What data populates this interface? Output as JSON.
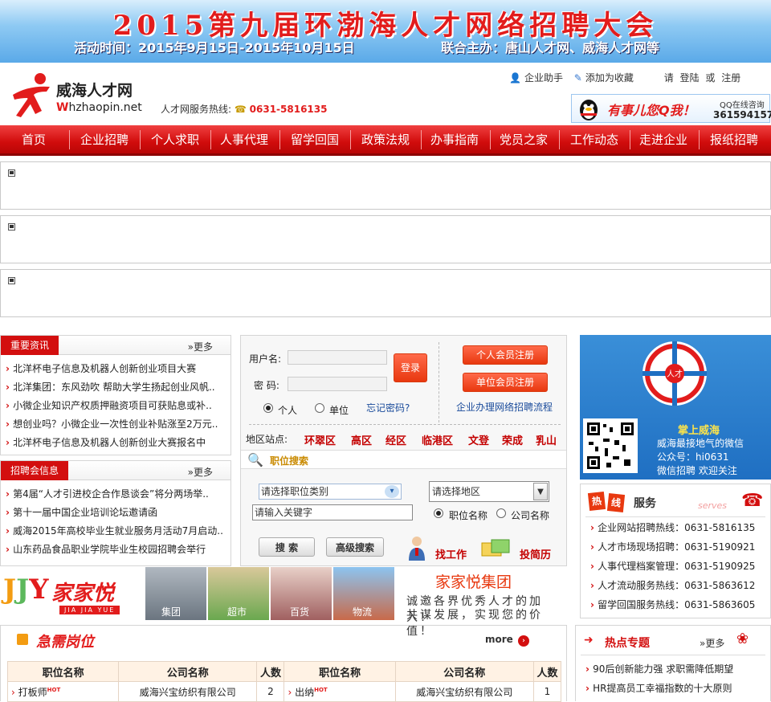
{
  "banner": {
    "title": "2015第九届环渤海人才网络招聘大会",
    "time": "活动时间：2015年9月15日-2015年10月15日",
    "host": "联合主办：唐山人才网、威海人才网等"
  },
  "header": {
    "logo_cn": "威海人才网",
    "logo_en_first": "W",
    "logo_en_rest": "hzhaopin.net",
    "hotline_label": "人才网服务热线:",
    "hotline_number": "0631-5816135",
    "links": {
      "helper": "企业助手",
      "favorite": "添加为收藏",
      "please": "请",
      "login": "登陆",
      "or": "或",
      "register": "注册"
    },
    "qq": {
      "slogan": "有事儿您Q我！",
      "label": "QQ在线咨询",
      "number": "361594157"
    }
  },
  "nav": {
    "items": [
      "首页",
      "企业招聘",
      "个人求职",
      "人事代理",
      "留学回国",
      "政策法规",
      "办事指南",
      "党员之家",
      "工作动态",
      "走进企业",
      "报纸招聘"
    ]
  },
  "news": {
    "tab": "重要资讯",
    "more": "更多",
    "items": [
      "北洋杯电子信息及机器人创新创业项目大赛",
      "北洋集团：东风劲吹 帮助大学生扬起创业风帆..",
      "小微企业知识产权质押融资项目可获贴息或补..",
      "想创业吗？小微企业一次性创业补贴涨至2万元..",
      "北洋杯电子信息及机器人创新创业大赛报名中"
    ]
  },
  "fairs": {
    "tab": "招聘会信息",
    "more": "更多",
    "items": [
      "第4届“人才引进校企合作恳谈会”将分两场举..",
      "第十一届中国企业培训论坛邀请函",
      "威海2015年高校毕业生就业服务月活动7月启动..",
      "山东药品食品职业学院毕业生校园招聘会举行"
    ]
  },
  "login": {
    "username_label": "用户名:",
    "password_label": "密  码:",
    "login_button": "登录",
    "radio_personal": "个人",
    "radio_company": "单位",
    "forgot": "忘记密码?",
    "personal_register": "个人会员注册",
    "company_register": "单位会员注册",
    "process_link": "企业办理网络招聘流程",
    "district_label": "地区站点:",
    "districts": [
      "环翠区",
      "高区",
      "经区",
      "临港区",
      "文登",
      "荣成",
      "乳山"
    ],
    "search_title": "职位搜索",
    "category_placeholder": "请选择职位类别",
    "area_select": "请选择地区",
    "keyword_placeholder": "请输入关键字",
    "radio_position": "职位名称",
    "radio_company_name": "公司名称",
    "search_button": "搜 索",
    "advanced_button": "高级搜索",
    "find_job": "找工作",
    "post_resume": "投简历"
  },
  "weixin": {
    "emblem_text": "人才",
    "title": "掌上威海",
    "line1": "威海最接地气的微信",
    "line2": "公众号：hi0631",
    "line3": "微信招聘 欢迎关注"
  },
  "services": {
    "title_hot1": "热",
    "title_hot2": "线",
    "title": "服务",
    "title_en": "serves",
    "items": [
      "企业网站招聘热线：0631-5816135",
      "人才市场现场招聘：0631-5190921",
      "人事代理档案管理：0631-5190925",
      "人才流动服务热线：0631-5863612",
      "留学回国服务热线：0631-5863605"
    ]
  },
  "promo": {
    "brand": "家家悦",
    "brand_pinyin": "JIA JIA YUE",
    "photos": [
      "集团",
      "超市",
      "百货",
      "物流"
    ],
    "group": "家家悦集团",
    "slogan1": "诚邀各界优秀人才的加入！",
    "slogan2": "共谋发展，实现您的价值！"
  },
  "jobs": {
    "title": "急需岗位",
    "more": "more",
    "headers": [
      "职位名称",
      "公司名称",
      "人数",
      "职位名称",
      "公司名称",
      "人数"
    ],
    "rows": [
      {
        "job1": "打板师",
        "company1": "威海兴宝纺织有限公司",
        "count1": "2",
        "job2": "出纳",
        "company2": "威海兴宝纺织有限公司",
        "count2": "1"
      }
    ],
    "hot": "HOT"
  },
  "topics": {
    "title": "热点专题",
    "more": "更多",
    "items": [
      "90后创新能力强 求职需降低期望",
      "HR提高员工幸福指数的十大原则"
    ]
  },
  "colors": {
    "brand_red": "#d30f0f",
    "nav_red": "#d10c0c",
    "banner_blue": "#5aa9e8"
  }
}
